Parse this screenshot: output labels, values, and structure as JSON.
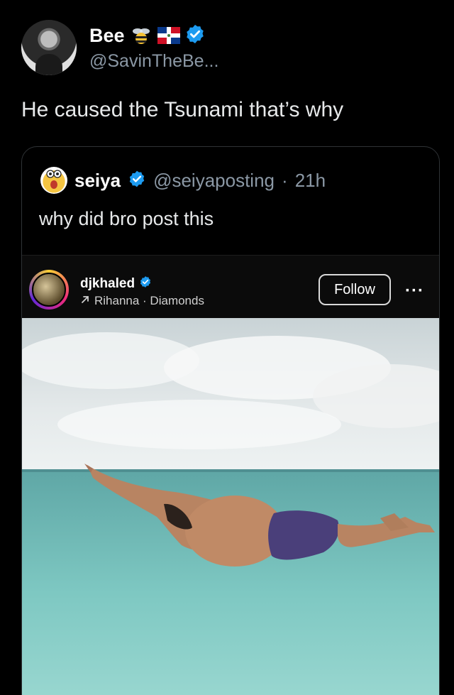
{
  "tweet": {
    "display_name": "Bee",
    "handle": "@SavinTheBe...",
    "text": "He caused the Tsunami that’s why",
    "verified": true,
    "name_emojis": [
      "bee-emoji",
      "dominican-flag-emoji"
    ]
  },
  "quoted": {
    "display_name": "seiya",
    "handle": "@seiyaposting",
    "separator": "·",
    "time": "21h",
    "text": "why did bro post this",
    "verified": true
  },
  "instagram": {
    "username": "djkhaled",
    "verified": true,
    "music": "Rihanna · Diamonds",
    "follow_label": "Follow",
    "more_label": "···"
  },
  "colors": {
    "background": "#000000",
    "text_primary": "#e7e9ea",
    "text_secondary": "#8b98a5",
    "verified_blue": "#1d9bf0",
    "border": "#2f3336"
  }
}
